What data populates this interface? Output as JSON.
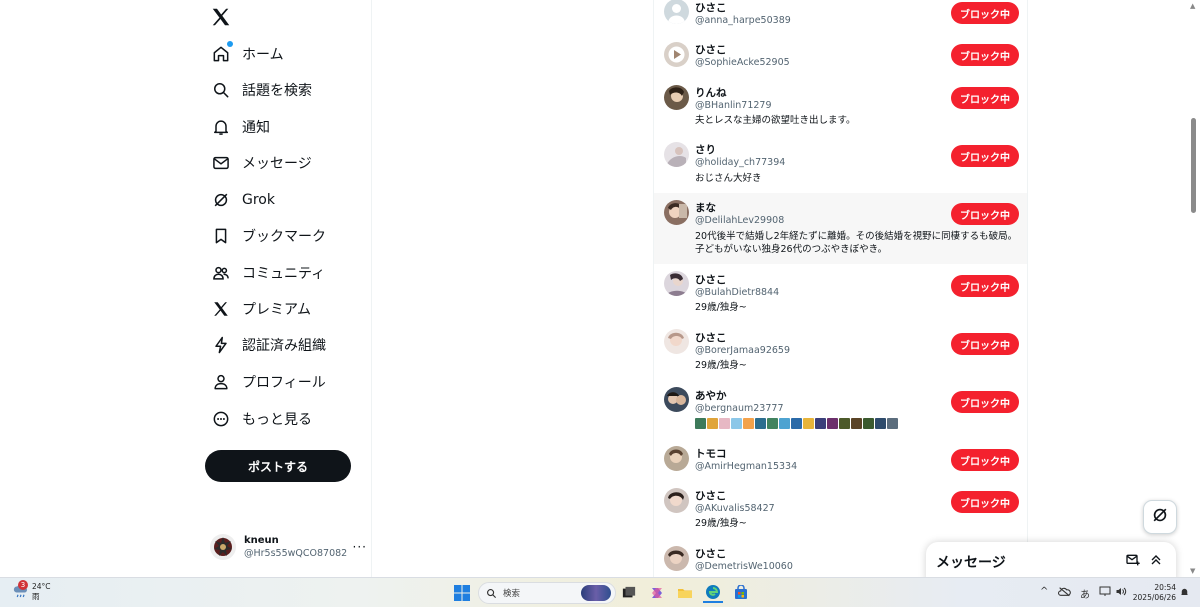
{
  "nav": {
    "items": [
      {
        "label": "ホーム",
        "icon": "home-icon"
      },
      {
        "label": "話題を検索",
        "icon": "search-icon"
      },
      {
        "label": "通知",
        "icon": "bell-icon"
      },
      {
        "label": "メッセージ",
        "icon": "mail-icon"
      },
      {
        "label": "Grok",
        "icon": "grok-icon"
      },
      {
        "label": "ブックマーク",
        "icon": "bookmark-icon"
      },
      {
        "label": "コミュニティ",
        "icon": "community-icon"
      },
      {
        "label": "プレミアム",
        "icon": "x-logo-icon"
      },
      {
        "label": "認証済み組織",
        "icon": "lightning-icon"
      },
      {
        "label": "プロフィール",
        "icon": "person-icon"
      },
      {
        "label": "もっと見る",
        "icon": "more-circle-icon"
      }
    ],
    "post_label": "ポストする"
  },
  "account": {
    "name": "kneun",
    "handle": "@Hr5s55wQCO87082",
    "more": "···"
  },
  "blocked": {
    "button_label": "ブロック中",
    "users": [
      {
        "name": "ひさこ",
        "handle": "@anna_harpe50389",
        "bio": ""
      },
      {
        "name": "ひさこ",
        "handle": "@SophieAcke52905",
        "bio": ""
      },
      {
        "name": "りんね",
        "handle": "@BHanlin71279",
        "bio": "夫とレスな主婦の欲望吐き出します。"
      },
      {
        "name": "さり",
        "handle": "@holiday_ch77394",
        "bio": "おじさん大好き"
      },
      {
        "name": "まな",
        "handle": "@DelilahLev29908",
        "bio": "20代後半で結婚し2年経たずに離婚。その後結婚を視野に同棲するも破局。子どもがいない独身26代のつぶやきぼやき。"
      },
      {
        "name": "ひさこ",
        "handle": "@BulahDietr8844",
        "bio": "29歳/独身~"
      },
      {
        "name": "ひさこ",
        "handle": "@BorerJamaa92659",
        "bio": "29歳/独身~"
      },
      {
        "name": "あやか",
        "handle": "@bergnaum23777",
        "bio": ""
      },
      {
        "name": "トモコ",
        "handle": "@AmirHegman15334",
        "bio": ""
      },
      {
        "name": "ひさこ",
        "handle": "@AKuvalis58427",
        "bio": "29歳/独身~"
      },
      {
        "name": "ひさこ",
        "handle": "@DemetrisWe10060",
        "bio": ""
      }
    ]
  },
  "messages_drawer": {
    "title": "メッセージ"
  },
  "taskbar": {
    "weather_temp": "24°C",
    "weather_desc": "雨",
    "notification_count": "3",
    "search_placeholder": "検索",
    "time": "20:54",
    "date": "2025/06/26",
    "ime": "あ"
  },
  "colors": {
    "block_button": "#f4212e",
    "accent": "#1d9bf0",
    "text": "#0f1419",
    "muted": "#536471"
  }
}
